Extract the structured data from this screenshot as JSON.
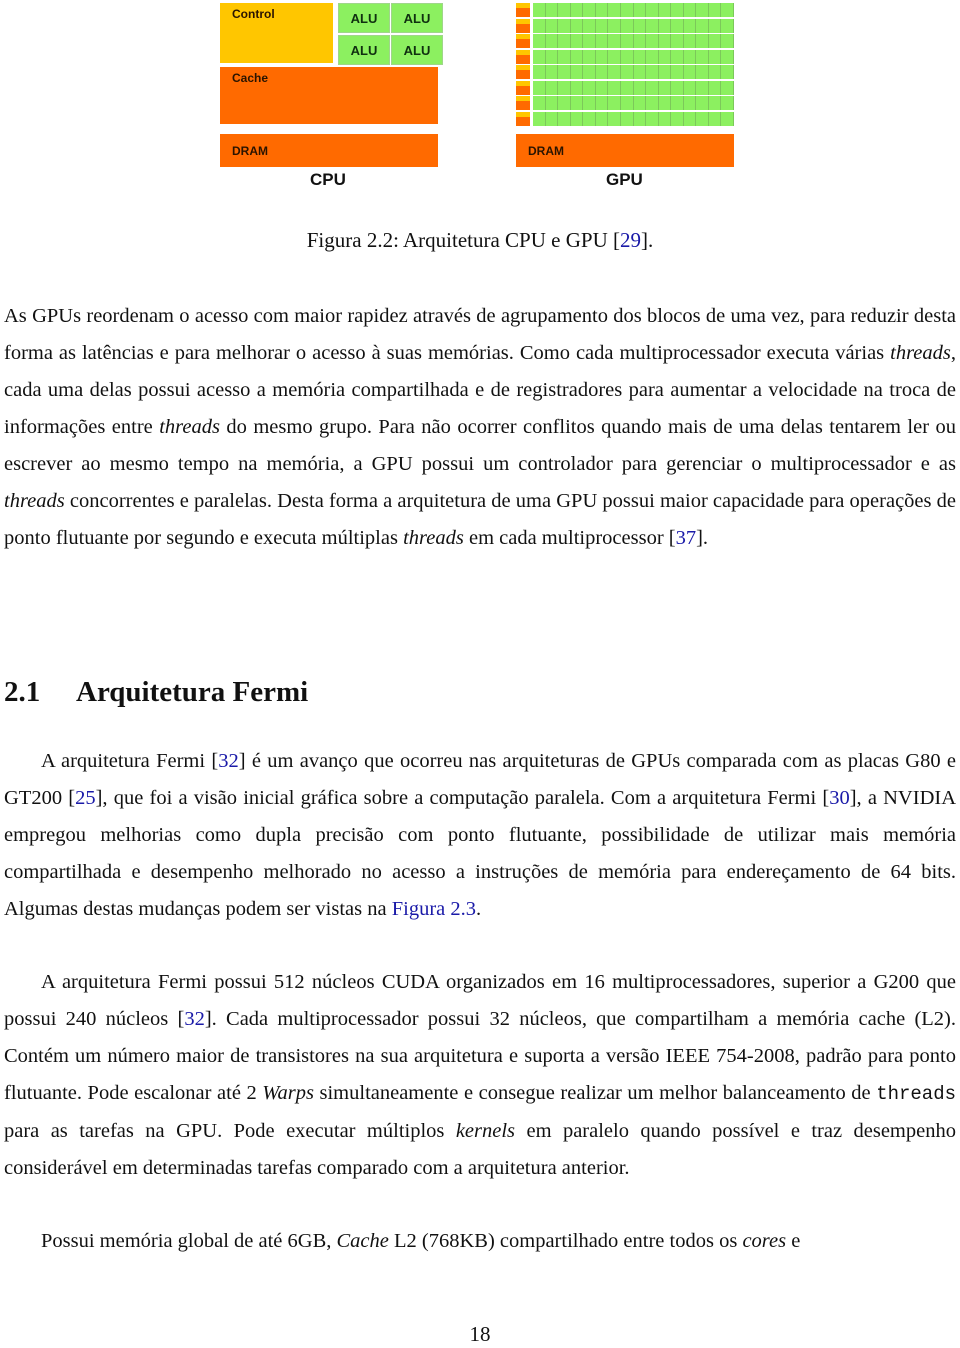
{
  "figure": {
    "cpu": {
      "control_label": "Control",
      "alu_labels": [
        "ALU",
        "ALU",
        "ALU",
        "ALU"
      ],
      "cache_label": "Cache",
      "dram_label": "DRAM",
      "title": "CPU"
    },
    "gpu": {
      "rows": 8,
      "alus_per_row": 16,
      "dram_label": "DRAM",
      "title": "GPU"
    },
    "colors": {
      "control": "#ffc600",
      "alu": "#8cf060",
      "cache": "#ff6a00",
      "dram": "#ff6a00"
    },
    "caption": {
      "prefix": "Figura 2.2: Arquitetura CPU e GPU [",
      "ref": "29",
      "suffix": "]."
    }
  },
  "paragraph1": {
    "t1": "As GPUs reordenam o acesso com maior rapidez através de agrupamento dos blocos de uma vez, para reduzir desta forma as latências e para melhorar o acesso à suas memórias.  Como cada multiprocessador executa várias ",
    "e1": "threads",
    "t2": ", cada uma delas possui acesso a memória compartilhada e de registradores para aumentar a velocidade na troca de informações entre ",
    "e2": "threads",
    "t3": " do mesmo grupo.  Para não ocorrer conflitos quando mais de uma delas tentarem ler ou escrever ao mesmo tempo na memória, a GPU possui um controlador para gerenciar o multiprocessador e as ",
    "e3": "threads",
    "t4": " concorrentes e paralelas.  Desta forma a arquitetura de uma GPU possui maior capacidade para operações de ponto flutuante por segundo e executa múltiplas ",
    "e4": "threads",
    "t5": " em cada multiprocessor [",
    "ref": "37",
    "t6": "]."
  },
  "section": {
    "number": "2.1",
    "title": "Arquitetura Fermi"
  },
  "paragraph2": {
    "t1": "A arquitetura Fermi [",
    "r1": "32",
    "t2": "] é um avanço que ocorreu nas arquiteturas de GPUs comparada com as placas G80 e GT200 [",
    "r2": "25",
    "t3": "], que foi a visão inicial gráfica sobre a computação paralela.  Com a arquitetura Fermi [",
    "r3": "30",
    "t4": "], a NVIDIA empregou melhorias como dupla precisão com ponto flutuante, possibilidade de utilizar mais memória compartilhada e desempenho melhorado no acesso a instruções de memória para endereçamento de 64 bits.  Algumas destas mudanças podem ser vistas na ",
    "link": "Figura 2.3",
    "t5": "."
  },
  "paragraph3": {
    "t1": "A arquitetura Fermi possui 512 núcleos CUDA organizados em 16 multiprocessadores, superior a G200 que possui 240 núcleos [",
    "r1": "32",
    "t2": "].  Cada multiprocessador possui 32 núcleos, que compartilham a memória cache (L2).  Contém um número maior de transistores na sua arquitetura e suporta a versão IEEE 754-2008, padrão para ponto flutuante. Pode escalonar até 2 ",
    "e1": "Warps",
    "t3": " simultaneamente e consegue realizar um melhor balanceamento de ",
    "code": "threads",
    "t4": " para as tarefas na GPU. Pode executar múltiplos ",
    "e2": "kernels",
    "t5": " em paralelo quando possível e traz desempenho considerável em determinadas tarefas comparado com a arquitetura anterior."
  },
  "paragraph4": {
    "t1": "Possui memória global de até 6GB, ",
    "e1": "Cache",
    "t2": " L2 (768KB) compartilhado entre todos os ",
    "e2": "cores",
    "t3": " e"
  },
  "page_number": "18"
}
